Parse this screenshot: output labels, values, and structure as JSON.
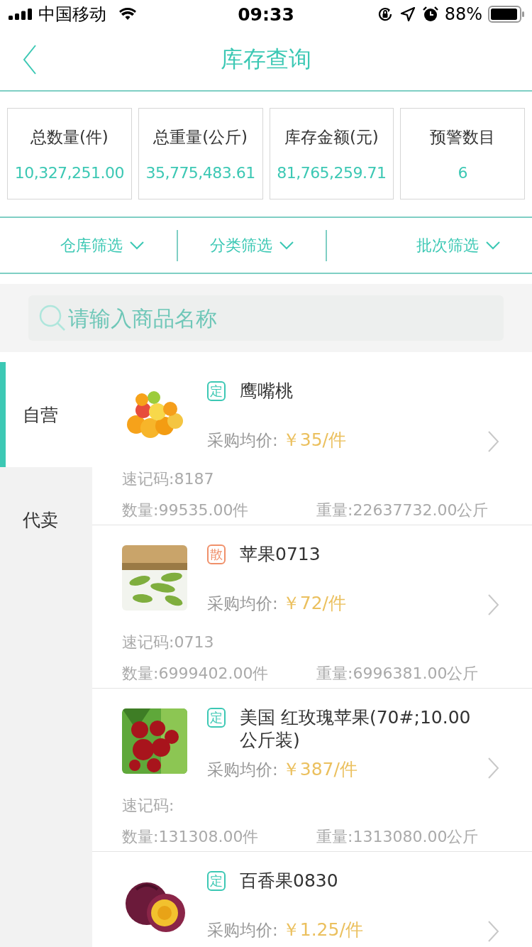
{
  "status_bar": {
    "carrier": "中国移动",
    "time": "09:33",
    "battery": "88%"
  },
  "nav": {
    "title": "库存查询"
  },
  "stats": [
    {
      "label": "总数量(件)",
      "value": "10,327,251.00"
    },
    {
      "label": "总重量(公斤)",
      "value": "35,775,483.61"
    },
    {
      "label": "库存金额(元)",
      "value": "81,765,259.71"
    },
    {
      "label": "预警数目",
      "value": "6"
    }
  ],
  "filters": [
    "仓库筛选",
    "分类筛选",
    "批次筛选"
  ],
  "search": {
    "placeholder": "请输入商品名称"
  },
  "sidebar": {
    "items": [
      {
        "label": "自营",
        "selected": true
      },
      {
        "label": "代卖",
        "selected": false
      }
    ]
  },
  "products": [
    {
      "tag": "定",
      "color": "#3cc8b4",
      "name": "鹰嘴桃",
      "price_label": "采购均价:",
      "price": "￥35/件",
      "code": "速记码:8187",
      "quantity": "数量:99535.00件",
      "weight": "重量:22637732.00公斤"
    },
    {
      "tag": "散",
      "color": "#f0906a",
      "name": "苹果0713",
      "price_label": "采购均价:",
      "price": "￥72/件",
      "code": "速记码:0713",
      "quantity": "数量:6999402.00件",
      "weight": "重量:6996381.00公斤"
    },
    {
      "tag": "定",
      "color": "#3cc8b4",
      "name": "美国  红玫瑰苹果(70#;10.00公斤装)",
      "price_label": "采购均价:",
      "price": "￥387/件",
      "code": "速记码:",
      "quantity": "数量:131308.00件",
      "weight": "重量:1313080.00公斤"
    },
    {
      "tag": "定",
      "color": "#3cc8b4",
      "name": "百香果0830",
      "price_label": "采购均价:",
      "price": "￥1.25/件"
    }
  ]
}
